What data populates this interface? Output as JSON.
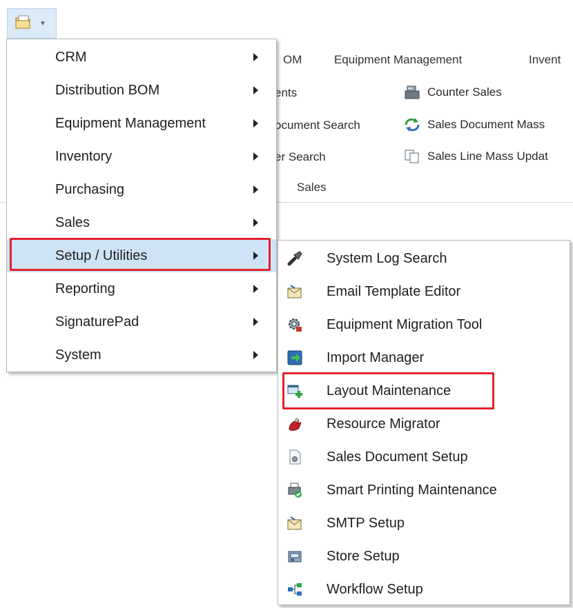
{
  "ribbon": {
    "tabs": [
      "OM",
      "Equipment Management",
      "Invent"
    ],
    "commands": {
      "col1": [
        "ents",
        "ocument Search",
        "er Search"
      ],
      "col2": [
        "Counter Sales",
        "Sales Document Mass",
        "Sales Line Mass Updat"
      ]
    },
    "group_label": "Sales"
  },
  "main_menu": {
    "items": [
      "CRM",
      "Distribution BOM",
      "Equipment Management",
      "Inventory",
      "Purchasing",
      "Sales",
      "Setup / Utilities",
      "Reporting",
      "SignaturePad",
      "System"
    ],
    "highlighted": "Setup / Utilities"
  },
  "sub_menu": {
    "items": [
      {
        "label": "System Log Search",
        "icon": "flashlight-icon"
      },
      {
        "label": "Email Template Editor",
        "icon": "envelope-icon"
      },
      {
        "label": "Equipment Migration Tool",
        "icon": "gear-migrate-icon"
      },
      {
        "label": "Import Manager",
        "icon": "import-icon"
      },
      {
        "label": "Layout Maintenance",
        "icon": "layout-add-icon"
      },
      {
        "label": "Resource Migrator",
        "icon": "resource-icon"
      },
      {
        "label": "Sales Document Setup",
        "icon": "document-gear-icon"
      },
      {
        "label": "Smart Printing Maintenance",
        "icon": "printer-icon"
      },
      {
        "label": "SMTP Setup",
        "icon": "envelope-icon"
      },
      {
        "label": "Store Setup",
        "icon": "store-icon"
      },
      {
        "label": "Workflow Setup",
        "icon": "workflow-icon"
      }
    ],
    "highlighted": "Layout Maintenance"
  },
  "colors": {
    "highlight_fill": "#cfe3f7",
    "highlight_border": "#e2222a"
  }
}
